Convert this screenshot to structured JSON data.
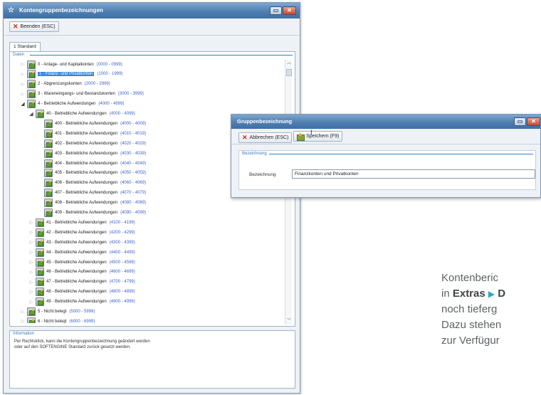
{
  "main_window": {
    "title": "Kontengruppenbezeichnungen",
    "toolbar": {
      "close_label": "Beenden (ESC)"
    },
    "tab_label": "1 Standard",
    "data_group_label": "Daten",
    "tree_rows": [
      {
        "name": "0 - Anlage- und Kapitalkonten",
        "range": "(0000 - 0999)",
        "toggle": "▷",
        "selected": false
      },
      {
        "name": "1 - Finanz- und Privatkonten",
        "range": "(1000 - 1999)",
        "toggle": "▷",
        "selected": true
      },
      {
        "name": "2 - Abgrenzungskonten",
        "range": "(2000 - 2999)",
        "toggle": "▷",
        "selected": false
      },
      {
        "name": "3 - Wareneingangs- und Bestandskonten",
        "range": "(3000 - 3999)",
        "toggle": "▷",
        "selected": false
      },
      {
        "name": "4 - Betriebliche Aufwendungen",
        "range": "(4000 - 4999)",
        "toggle": "◢",
        "selected": false
      },
      {
        "name": "40 - Betriebliche Aufwendungen",
        "range": "(4000 - 4099)",
        "toggle": "◢",
        "selected": false
      },
      {
        "name": "400 - Betriebliche Aufwendungen",
        "range": "(4000 - 4009)",
        "toggle": "",
        "selected": false
      },
      {
        "name": "401 - Betriebliche Aufwendungen",
        "range": "(4010 - 4019)",
        "toggle": "",
        "selected": false
      },
      {
        "name": "402 - Betriebliche Aufwendungen",
        "range": "(4020 - 4029)",
        "toggle": "",
        "selected": false
      },
      {
        "name": "403 - Betriebliche Aufwendungen",
        "range": "(4030 - 4039)",
        "toggle": "",
        "selected": false
      },
      {
        "name": "404 - Betriebliche Aufwendungen",
        "range": "(4040 - 4049)",
        "toggle": "",
        "selected": false
      },
      {
        "name": "405 - Betriebliche Aufwendungen",
        "range": "(4050 - 4059)",
        "toggle": "",
        "selected": false
      },
      {
        "name": "406 - Betriebliche Aufwendungen",
        "range": "(4060 - 4069)",
        "toggle": "",
        "selected": false
      },
      {
        "name": "407 - Betriebliche Aufwendungen",
        "range": "(4070 - 4079)",
        "toggle": "",
        "selected": false
      },
      {
        "name": "408 - Betriebliche Aufwendungen",
        "range": "(4080 - 4089)",
        "toggle": "",
        "selected": false
      },
      {
        "name": "409 - Betriebliche Aufwendungen",
        "range": "(4090 - 4099)",
        "toggle": "",
        "selected": false
      },
      {
        "name": "41 - Betriebliche Aufwendungen",
        "range": "(4100 - 4199)",
        "toggle": "▷",
        "selected": false
      },
      {
        "name": "42 - Betriebliche Aufwendungen",
        "range": "(4200 - 4299)",
        "toggle": "▷",
        "selected": false
      },
      {
        "name": "43 - Betriebliche Aufwendungen",
        "range": "(4300 - 4399)",
        "toggle": "▷",
        "selected": false
      },
      {
        "name": "44 - Betriebliche Aufwendungen",
        "range": "(4400 - 4499)",
        "toggle": "▷",
        "selected": false
      },
      {
        "name": "45 - Betriebliche Aufwendungen",
        "range": "(4500 - 4599)",
        "toggle": "▷",
        "selected": false
      },
      {
        "name": "46 - Betriebliche Aufwendungen",
        "range": "(4600 - 4699)",
        "toggle": "▷",
        "selected": false
      },
      {
        "name": "47 - Betriebliche Aufwendungen",
        "range": "(4700 - 4799)",
        "toggle": "▷",
        "selected": false
      },
      {
        "name": "48 - Betriebliche Aufwendungen",
        "range": "(4800 - 4899)",
        "toggle": "▷",
        "selected": false
      },
      {
        "name": "49 - Betriebliche Aufwendungen",
        "range": "(4900 - 4999)",
        "toggle": "▷",
        "selected": false
      },
      {
        "name": "5 - Nicht belegt",
        "range": "(5000 - 5999)",
        "toggle": "▷",
        "selected": false
      },
      {
        "name": "6 - Nicht belegt",
        "range": "(6000 - 6999)",
        "toggle": "▷",
        "selected": false
      }
    ],
    "info_group_label": "Information",
    "info_lines": [
      "Per Rechtsklick, kann die Kontengruppenbezeichnung geändert werden",
      "oder auf den SOFTENGINE Standard zurück gesetzt werden."
    ]
  },
  "dialog": {
    "title": "Gruppenbezeichnung",
    "cancel_label": "Abbrechen (ESC)",
    "save_label": "Speichern (F9)",
    "group_label": "Bezeichnung",
    "field_label": "Bezeichnung",
    "field_value": "Finanzkonten und Privatkonten"
  },
  "side_text": {
    "line1": "Kontenberic",
    "line2_prefix": "in ",
    "line2_bold1": "Extras",
    "line2_bold2": "D",
    "line3": "noch tieferg",
    "line4": "Dazu stehen",
    "line5": "zur Verfügur"
  },
  "colors": {
    "titlebar": "#4f7fb2",
    "range_text": "#3f63c9",
    "selection": "#3a8ad8",
    "group_label": "#3a78b8",
    "arrow_accent": "#29a8c8"
  }
}
